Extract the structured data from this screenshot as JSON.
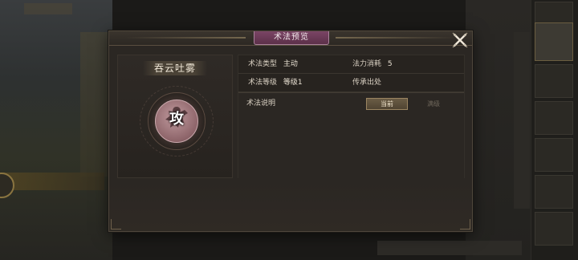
{
  "dialog": {
    "title": "术法预览",
    "close_icon": "close-x-icon"
  },
  "skill": {
    "name": "吞云吐雾",
    "emblem_text": "攻",
    "emblem_icon": "attack-emblem-icon"
  },
  "info": {
    "type_label": "术法类型",
    "type_value": "主动",
    "cost_label": "法力消耗",
    "cost_value": "5",
    "level_label": "术法等级",
    "level_value": "等级1",
    "source_label": "传承出处",
    "source_value": ""
  },
  "description": {
    "label": "术法说明",
    "tabs": [
      {
        "label": "当前",
        "active": true
      },
      {
        "label": "满级",
        "active": false
      }
    ]
  },
  "colors": {
    "title_tab": "#6a3a57",
    "panel_bg": "#2b2723",
    "active_tab": "#5e513c"
  }
}
